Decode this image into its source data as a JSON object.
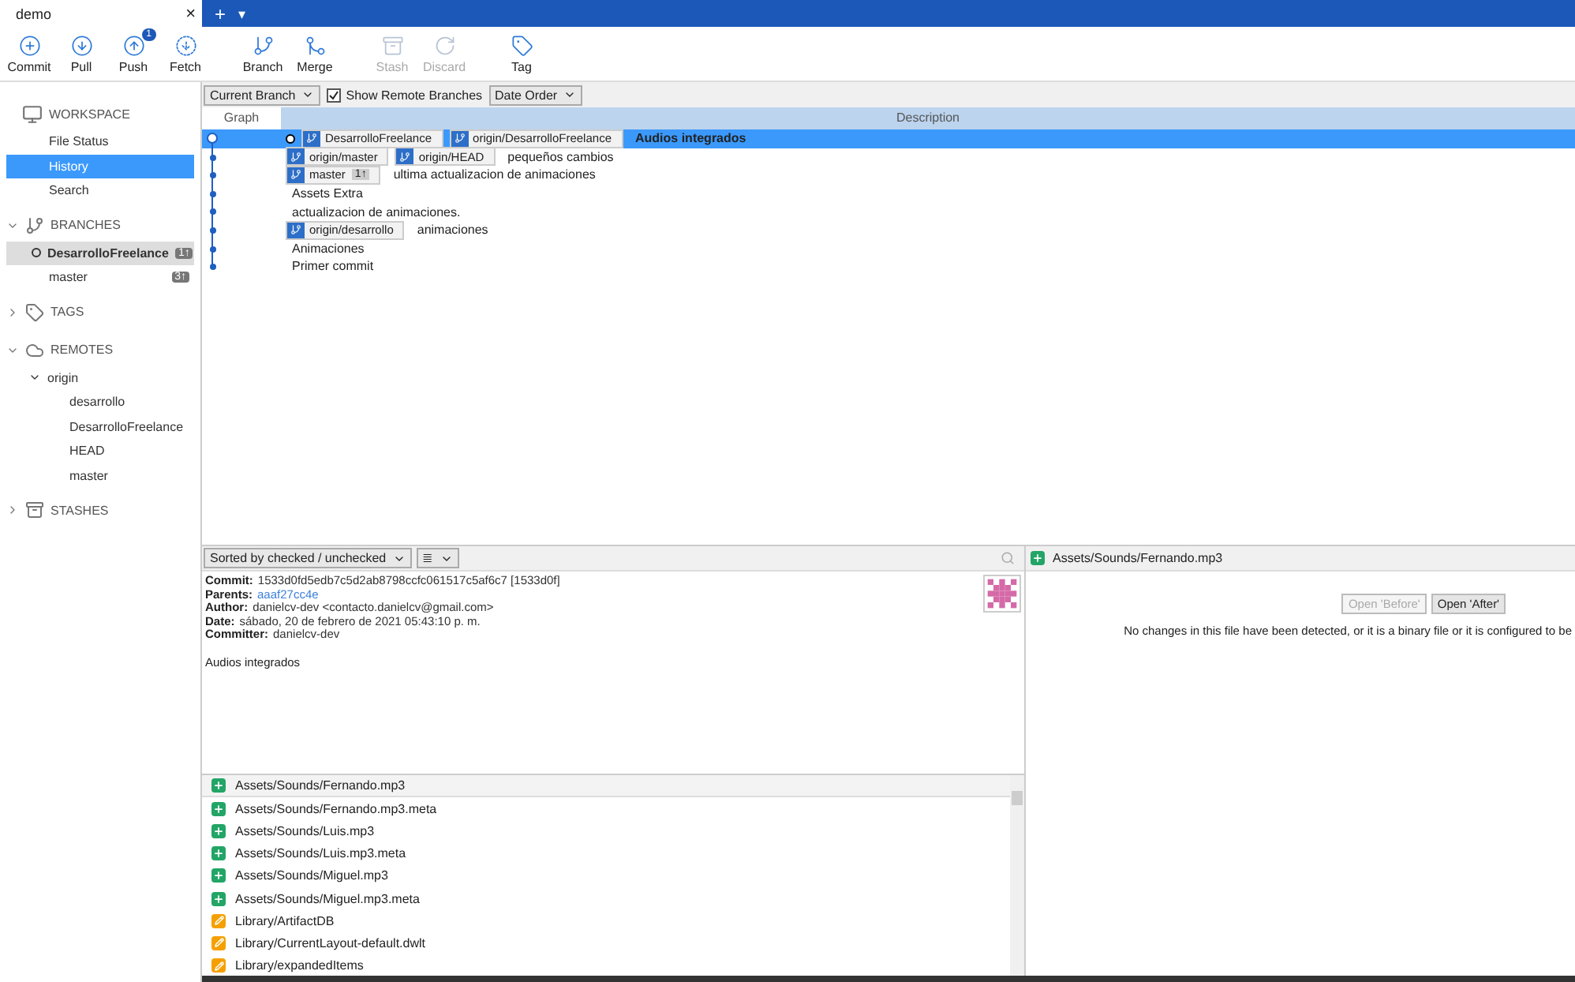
{
  "tab": {
    "title": "demo",
    "close": "×",
    "add": "+",
    "menu": "▾"
  },
  "toolbar": [
    {
      "kind": "commit",
      "label": "Commit",
      "disabled": false
    },
    {
      "kind": "pull",
      "label": "Pull",
      "disabled": false
    },
    {
      "kind": "push",
      "label": "Push",
      "disabled": false,
      "badge": "1"
    },
    {
      "kind": "fetch",
      "label": "Fetch",
      "disabled": false
    },
    {
      "kind": "branch",
      "label": "Branch",
      "disabled": false
    },
    {
      "kind": "merge",
      "label": "Merge",
      "disabled": false
    },
    {
      "kind": "stash",
      "label": "Stash",
      "disabled": true
    },
    {
      "kind": "discard",
      "label": "Discard",
      "disabled": true
    },
    {
      "kind": "tag",
      "label": "Tag",
      "disabled": false
    }
  ],
  "sidebar": {
    "workspace": {
      "title": "WORKSPACE",
      "items": [
        {
          "label": "File Status",
          "selected": false
        },
        {
          "label": "History",
          "selected": true
        },
        {
          "label": "Search",
          "selected": false
        }
      ]
    },
    "branches": {
      "title": "BRANCHES",
      "expanded": true,
      "items": [
        {
          "label": "DesarrolloFreelance",
          "current": true,
          "badge": "1↑"
        },
        {
          "label": "master",
          "current": false,
          "badge": "3↑"
        }
      ]
    },
    "tags": {
      "title": "TAGS",
      "expanded": false
    },
    "remotes": {
      "title": "REMOTES",
      "expanded": true,
      "items": [
        {
          "label": "origin",
          "expanded": true,
          "children": [
            {
              "label": "desarrollo"
            },
            {
              "label": "DesarrolloFreelance"
            },
            {
              "label": "HEAD"
            },
            {
              "label": "master"
            }
          ]
        }
      ]
    },
    "stashes": {
      "title": "STASHES",
      "expanded": false
    }
  },
  "filters": {
    "branch": "Current Branch",
    "show_remote": {
      "label": "Show Remote Branches",
      "checked": true
    },
    "order": "Date Order"
  },
  "columns": [
    "Graph",
    "Description"
  ],
  "commits": [
    {
      "selected": true,
      "head": true,
      "refs": [
        {
          "name": "DesarrolloFreelance"
        },
        {
          "name": "origin/DesarrolloFreelance"
        }
      ],
      "message": "Audios integrados"
    },
    {
      "selected": false,
      "head": false,
      "refs": [
        {
          "name": "origin/master"
        },
        {
          "name": "origin/HEAD"
        }
      ],
      "message": "pequeños cambios"
    },
    {
      "selected": false,
      "head": false,
      "refs": [
        {
          "name": "master",
          "badge": "1↑"
        }
      ],
      "message": "ultima actualizacion de animaciones"
    },
    {
      "selected": false,
      "head": false,
      "message": "Assets Extra"
    },
    {
      "selected": false,
      "head": false,
      "message": "actualizacion de animaciones."
    },
    {
      "selected": false,
      "head": false,
      "refs": [
        {
          "name": "origin/desarrollo"
        }
      ],
      "message": "animaciones"
    },
    {
      "selected": false,
      "head": false,
      "message": "Animaciones"
    },
    {
      "selected": false,
      "head": false,
      "message": "Primer commit"
    }
  ],
  "details": {
    "sort": "Sorted by checked / unchecked",
    "view": "≣",
    "fields": [
      {
        "label": "Commit:",
        "value": "1533d0fd5edb7c5d2ab8798ccfc061517c5af6c7 [1533d0f]",
        "link": false
      },
      {
        "label": "Parents:",
        "value": "aaaf27cc4e",
        "link": true
      },
      {
        "label": "Author:",
        "value": "danielcv-dev <contacto.danielcv@gmail.com>",
        "link": false
      },
      {
        "label": "Date:",
        "value": "sábado, 20 de febrero de 2021 05:43:10 p. m.",
        "link": false
      },
      {
        "label": "Committer:",
        "value": "danielcv-dev",
        "link": false
      }
    ],
    "message": "Audios integrados"
  },
  "files": [
    {
      "path": "Assets/Sounds/Fernando.mp3",
      "kind": "added",
      "selected": true
    },
    {
      "path": "Assets/Sounds/Fernando.mp3.meta",
      "kind": "added",
      "selected": false
    },
    {
      "path": "Assets/Sounds/Luis.mp3",
      "kind": "added",
      "selected": false
    },
    {
      "path": "Assets/Sounds/Luis.mp3.meta",
      "kind": "added",
      "selected": false
    },
    {
      "path": "Assets/Sounds/Miguel.mp3",
      "kind": "added",
      "selected": false
    },
    {
      "path": "Assets/Sounds/Miguel.mp3.meta",
      "kind": "added",
      "selected": false
    },
    {
      "path": "Library/ArtifactDB",
      "kind": "modified",
      "selected": false
    },
    {
      "path": "Library/CurrentLayout-default.dwlt",
      "kind": "modified",
      "selected": false
    },
    {
      "path": "Library/expandedItems",
      "kind": "modified",
      "selected": false
    }
  ],
  "diff": {
    "path": "Assets/Sounds/Fernando.mp3",
    "kind": "added",
    "buttons": [
      {
        "label": "Open 'Before'",
        "disabled": true
      },
      {
        "label": "Open 'After'",
        "disabled": false
      }
    ],
    "message": "No changes in this file have been detected, or it is a binary file or it is configured to be"
  }
}
